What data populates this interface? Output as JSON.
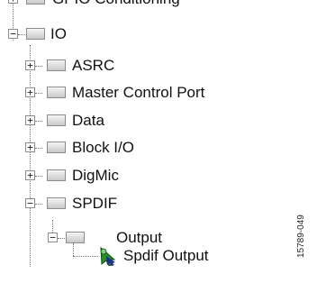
{
  "tree": {
    "items": [
      {
        "label": "GPIO Conditioning",
        "expander": "+"
      },
      {
        "label": "IO",
        "expander": "−"
      },
      {
        "label": "ASRC",
        "expander": "+"
      },
      {
        "label": "Master Control Port",
        "expander": "+"
      },
      {
        "label": "Data",
        "expander": "+"
      },
      {
        "label": "Block I/O",
        "expander": "+"
      },
      {
        "label": "DigMic",
        "expander": "+"
      },
      {
        "label": "SPDIF",
        "expander": "−"
      },
      {
        "label": "Output",
        "expander": "−"
      },
      {
        "label": "Spdif Output"
      }
    ]
  },
  "figure_id": "15789-049",
  "colors": {
    "connector": "#777777",
    "leaf_icon_arrow": "#2a8f2a"
  }
}
